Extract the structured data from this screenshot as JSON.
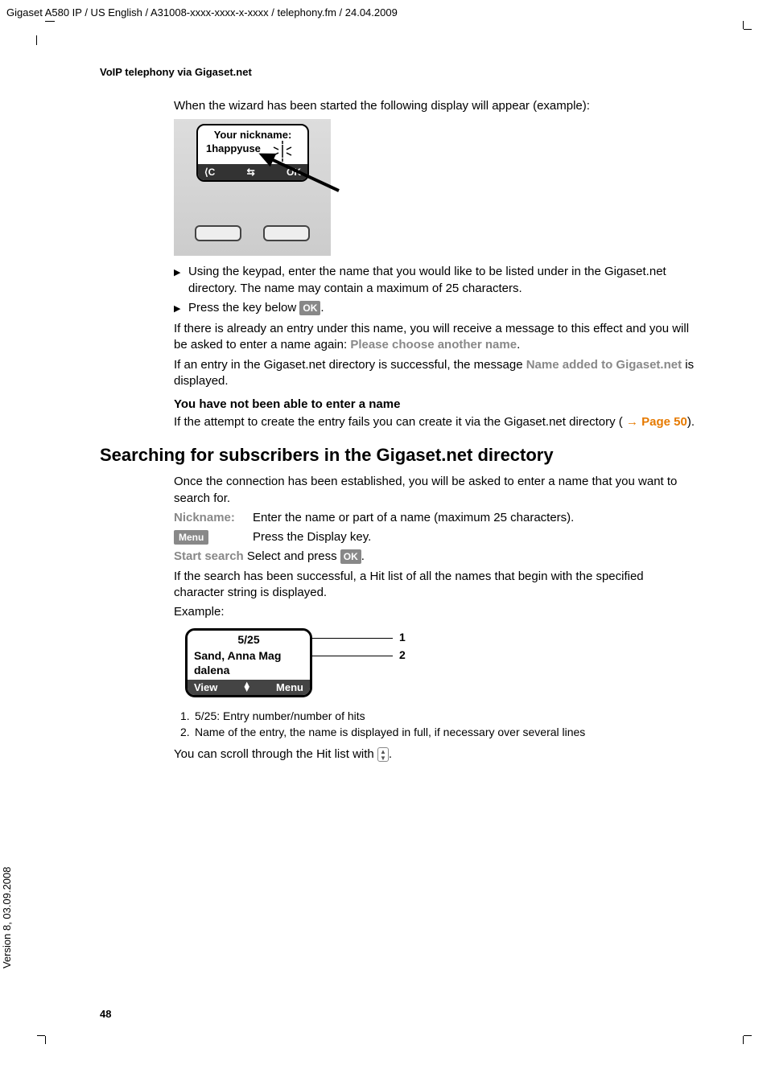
{
  "header_path": "Gigaset A580 IP / US English / A31008-xxxx-xxxx-x-xxxx / telephony.fm / 24.04.2009",
  "side_version": "Version 8, 03.09.2008",
  "page_number": "48",
  "section_title": "VoIP telephony via Gigaset.net",
  "intro": "When the wizard has been started the following display will appear (example):",
  "phone1": {
    "title": "Your nickname:",
    "input": "1happyuse",
    "soft_left": "⟨C",
    "soft_mid": "⇆",
    "soft_right": "OK"
  },
  "bullet1": "Using the keypad, enter the name that you would like to be listed under in the Gigaset.net directory. The name may contain a maximum of 25 characters.",
  "bullet2_pre": "Press the key below ",
  "bullet2_post": ".",
  "ok_label": "OK",
  "para_already_a": "If there is already an entry under this name, you will receive a message to this effect and you will be asked to enter a name again: ",
  "para_already_msg": "Please choose another name",
  "para_already_b": ".",
  "para_success_a": "If an entry in the Gigaset.net directory is successful, the message ",
  "para_success_msg": "Name added to Gigaset.net",
  "para_success_b": " is displayed.",
  "subhead_noname": "You have not been able to enter a name",
  "para_retry_a": "If the attempt to create the entry fails you can create it via the Gigaset.net directory ( ",
  "para_retry_arrow": "→",
  "para_retry_link": "Page 50",
  "para_retry_b": ").",
  "h2_search": "Searching for subscribers in the Gigaset.net directory",
  "search_intro": "Once the connection has been established, you will be asked to enter a name that you want to search for.",
  "def_nickname_label": "Nickname:",
  "def_nickname_text": "Enter the name or part of a name (maximum 25 characters).",
  "def_menu_label": "Menu",
  "def_menu_text": "Press the Display key.",
  "def_start_label": "Start search",
  "def_start_text_a": " Select and press ",
  "def_start_text_b": ".",
  "para_hitlist": "If the search has been successful, a Hit list of all the names that begin with the specified character string is displayed.",
  "example_label": "Example:",
  "hitlist": {
    "counter": "5/25",
    "name_line1": "Sand, Anna Mag",
    "name_line2": "dalena",
    "soft_left": "View",
    "soft_right": "Menu"
  },
  "callout1_num": "1",
  "callout2_num": "2",
  "legend1_num": "1.",
  "legend1_text": "5/25: Entry number/number of hits",
  "legend2_num": "2.",
  "legend2_text": "Name of the entry, the name is displayed in full, if necessary over several lines",
  "scroll_text_a": "You can scroll through the Hit list with ",
  "scroll_text_b": "."
}
